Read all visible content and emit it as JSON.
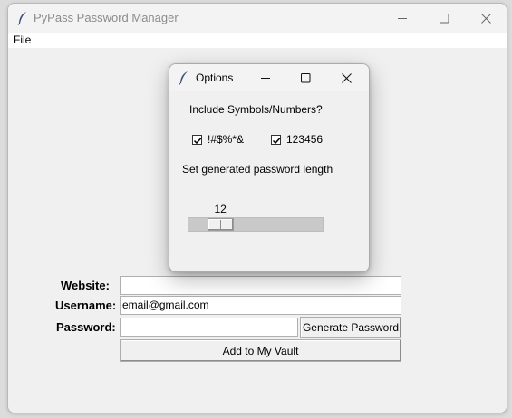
{
  "main_window": {
    "title": "PyPass Password Manager",
    "menu": {
      "file_label": "File"
    },
    "form": {
      "website_label": "Website:",
      "website_value": "",
      "username_label": "Username:",
      "username_value": "email@gmail.com",
      "password_label": "Password:",
      "password_value": "",
      "generate_button_label": "Generate Password",
      "add_button_label": "Add to My Vault"
    }
  },
  "options_dialog": {
    "title": "Options",
    "include_label": "Include Symbols/Numbers?",
    "symbols_checkbox": {
      "label": "!#$%*&",
      "checked": true
    },
    "numbers_checkbox": {
      "label": "123456",
      "checked": true
    },
    "length_label": "Set generated password length",
    "length_scale": {
      "value": "12",
      "min": 8,
      "max": 32
    }
  },
  "icons": {
    "app_icon": "feather-icon",
    "minimize": "minimize-icon",
    "maximize": "maximize-icon",
    "close": "close-icon",
    "checkmark": "checkmark-icon"
  }
}
